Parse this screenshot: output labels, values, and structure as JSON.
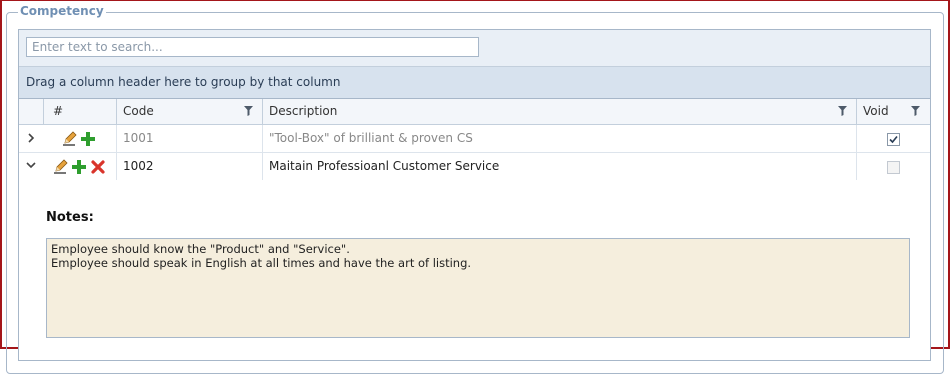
{
  "section": {
    "legend": "Competency"
  },
  "search": {
    "placeholder": "Enter text to search..."
  },
  "group_panel": {
    "text": "Drag a column header here to group by that column"
  },
  "columns": [
    {
      "label": "#"
    },
    {
      "label": "Code"
    },
    {
      "label": "Description"
    },
    {
      "label": "Void"
    }
  ],
  "rows": [
    {
      "code": "1001",
      "description": "\"Tool-Box\" of brilliant & proven CS",
      "void": true,
      "expanded": false
    },
    {
      "code": "1002",
      "description": "Maitain Professioanl Customer Service",
      "void": false,
      "expanded": true
    }
  ],
  "detail": {
    "notes_label": "Notes:",
    "notes_text": "Employee should know the \"Product\" and \"Service\".\nEmployee should speak in English at all times and have the art of listing."
  },
  "icons": {
    "expand": "chevron-right-icon",
    "collapse": "chevron-down-icon",
    "edit": "pencil-icon",
    "add": "plus-icon",
    "delete": "close-icon",
    "filter": "filter-icon"
  },
  "colors": {
    "border": "#a4161a",
    "legend": "#6f8fb3",
    "add": "#2e9e2e",
    "delete": "#d9342b",
    "notes_bg": "#f5eedd"
  }
}
